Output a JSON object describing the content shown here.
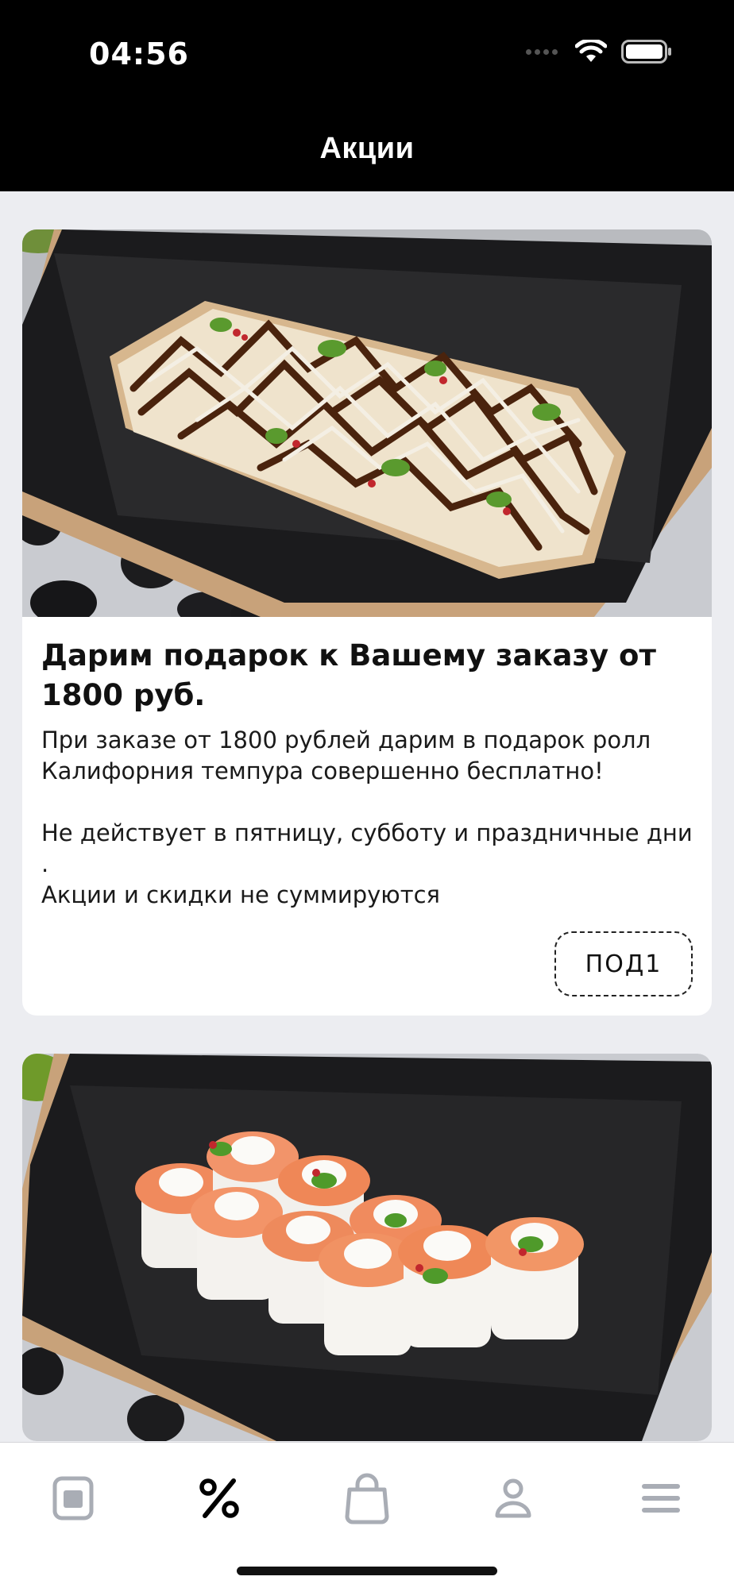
{
  "status_bar": {
    "time": "04:56"
  },
  "header": {
    "title": "Акции"
  },
  "promotions": [
    {
      "title": "Дарим подарок к Вашему заказу от 1800 руб.",
      "description_lines": [
        "При заказе от 1800 рублей дарим в подарок ролл Калифорния темпура совершенно бесплатно!",
        "",
        "Не действует в пятницу, субботу и праздничные дни .",
        "Акции и скидки не суммируются"
      ],
      "promo_code": "ПОД1",
      "image": "roll-tempura-box-photo"
    },
    {
      "image": "salmon-rolls-box-photo"
    }
  ],
  "tab_bar": {
    "items": [
      {
        "icon": "menu-card-icon",
        "active": false
      },
      {
        "icon": "percent-icon",
        "active": true
      },
      {
        "icon": "shopping-bag-icon",
        "active": false
      },
      {
        "icon": "profile-icon",
        "active": false
      },
      {
        "icon": "hamburger-menu-icon",
        "active": false
      }
    ]
  },
  "colors": {
    "header_bg": "#000000",
    "page_bg": "#ECEDF1",
    "tab_active": "#000000",
    "tab_inactive": "#A9ADB5"
  }
}
